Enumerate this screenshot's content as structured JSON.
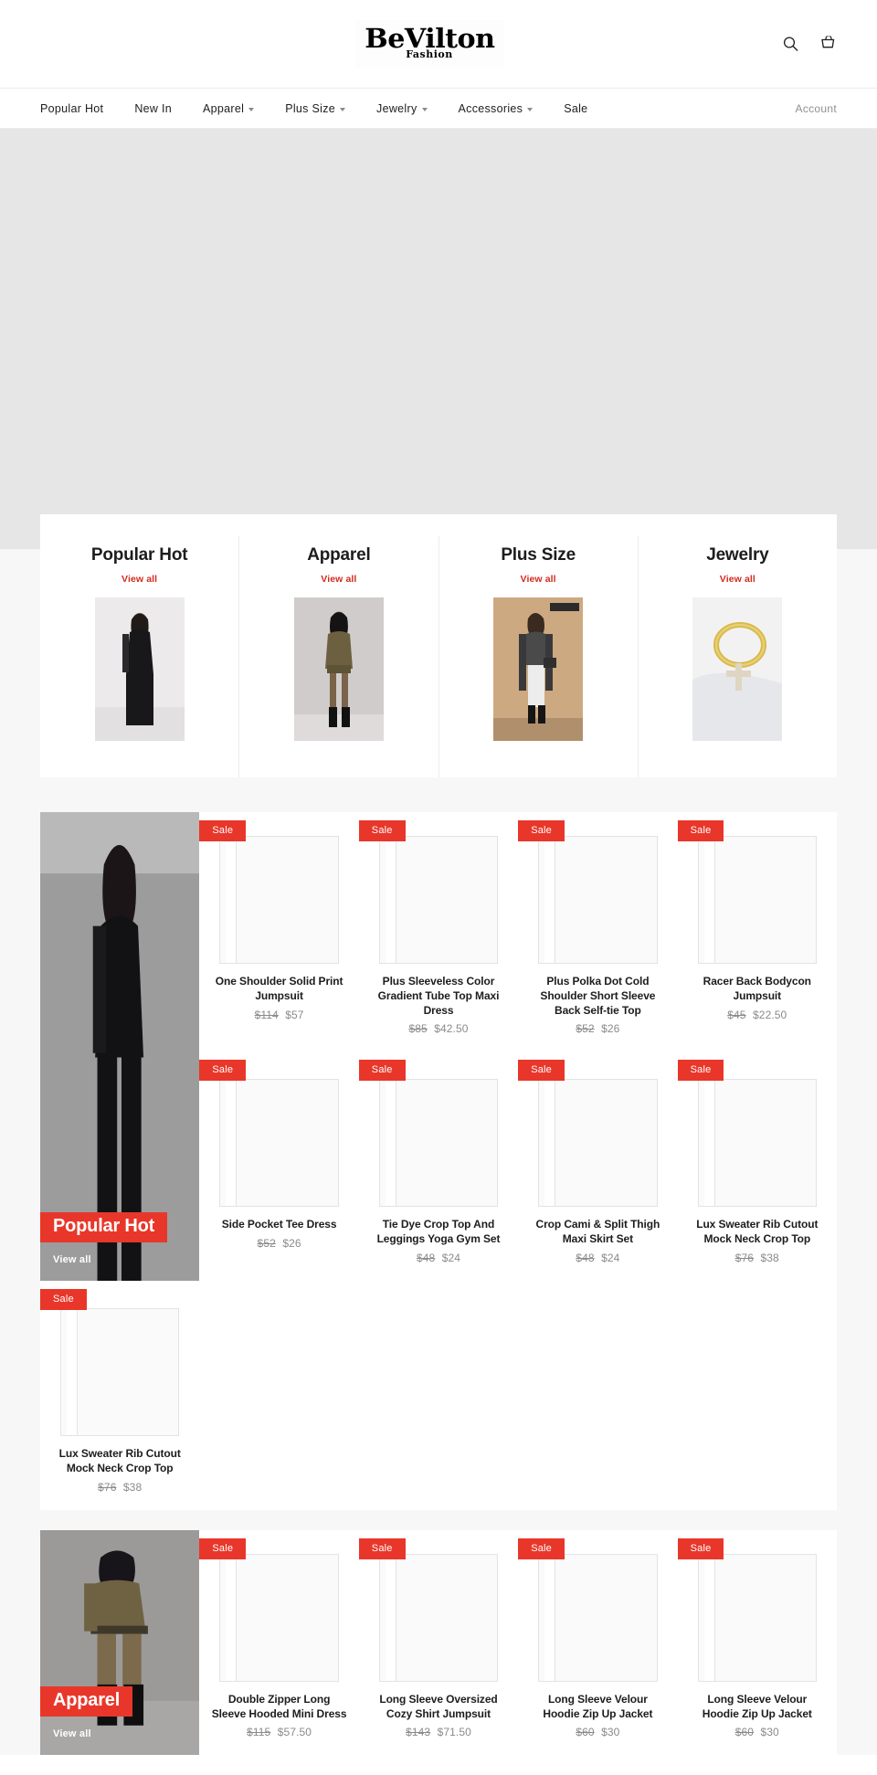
{
  "header": {
    "logo_main": "BeVilton",
    "logo_sub": "Fashion",
    "search_icon": "search-icon",
    "cart_icon": "cart-icon"
  },
  "nav": {
    "items": [
      {
        "label": "Popular Hot",
        "has_dropdown": false
      },
      {
        "label": "New In",
        "has_dropdown": false
      },
      {
        "label": "Apparel",
        "has_dropdown": true
      },
      {
        "label": "Plus Size",
        "has_dropdown": true
      },
      {
        "label": "Jewelry",
        "has_dropdown": true
      },
      {
        "label": "Accessories",
        "has_dropdown": true
      },
      {
        "label": "Sale",
        "has_dropdown": false
      }
    ],
    "account_label": "Account"
  },
  "collections": [
    {
      "title": "Popular Hot",
      "view_all": "View all"
    },
    {
      "title": "Apparel",
      "view_all": "View all"
    },
    {
      "title": "Plus Size",
      "view_all": "View all"
    },
    {
      "title": "Jewelry",
      "view_all": "View all"
    }
  ],
  "colors": {
    "sale_red": "#e8372a",
    "link_red": "#d32b1e",
    "hero_gray": "#e6e6e6",
    "page_bg": "#f7f7f7"
  },
  "badges": {
    "sale": "Sale",
    "view_all": "View all"
  },
  "sections": [
    {
      "promo": {
        "title": "Popular Hot",
        "view_all": "View all"
      },
      "rows": [
        [
          {
            "title": "One Shoulder Solid Print Jumpsuit",
            "price_old": "$114",
            "price_new": "$57",
            "badge": "Sale"
          },
          {
            "title": "Plus Sleeveless Color Gradient Tube Top Maxi Dress",
            "price_old": "$85",
            "price_new": "$42.50",
            "badge": "Sale"
          },
          {
            "title": "Plus Polka Dot Cold Shoulder Short Sleeve Back Self-tie Top",
            "price_old": "$52",
            "price_new": "$26",
            "badge": "Sale"
          },
          {
            "title": "Racer Back Bodycon Jumpsuit",
            "price_old": "$45",
            "price_new": "$22.50",
            "badge": "Sale"
          }
        ],
        [
          {
            "title": "Side Pocket Tee Dress",
            "price_old": "$52",
            "price_new": "$26",
            "badge": "Sale"
          },
          {
            "title": "Tie Dye Crop Top And Leggings Yoga Gym Set",
            "price_old": "$48",
            "price_new": "$24",
            "badge": "Sale"
          },
          {
            "title": "Crop Cami & Split Thigh Maxi Skirt Set",
            "price_old": "$48",
            "price_new": "$24",
            "badge": "Sale"
          },
          {
            "title": "Lux Sweater Rib Cutout Mock Neck Crop Top",
            "price_old": "$76",
            "price_new": "$38",
            "badge": "Sale"
          },
          {
            "title": "Lux Sweater Rib Cutout Mock Neck Crop Top",
            "price_old": "$76",
            "price_new": "$38",
            "badge": "Sale"
          }
        ]
      ]
    },
    {
      "promo": {
        "title": "Apparel",
        "view_all": "View all"
      },
      "rows": [
        [
          {
            "title": "Double Zipper Long Sleeve Hooded Mini Dress",
            "price_old": "$115",
            "price_new": "$57.50",
            "badge": "Sale"
          },
          {
            "title": "Long Sleeve Oversized Cozy Shirt Jumpsuit",
            "price_old": "$143",
            "price_new": "$71.50",
            "badge": "Sale"
          },
          {
            "title": "Long Sleeve Velour Hoodie Zip Up Jacket",
            "price_old": "$60",
            "price_new": "$30",
            "badge": "Sale"
          },
          {
            "title": "Long Sleeve Velour Hoodie Zip Up Jacket",
            "price_old": "$60",
            "price_new": "$30",
            "badge": "Sale"
          }
        ]
      ]
    }
  ]
}
